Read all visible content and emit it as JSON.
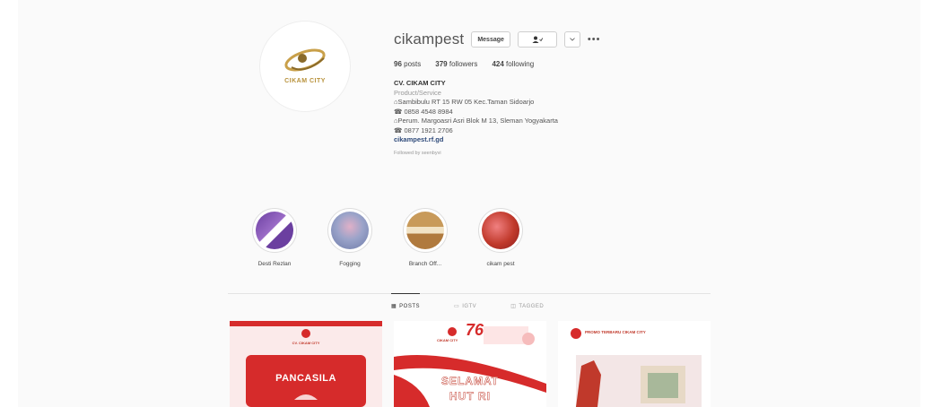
{
  "profile": {
    "username": "cikampest",
    "message_btn": "Message",
    "follow_icon": "person-check-icon",
    "more_icon": "more-icon",
    "avatar_brand": "CIKAM CITY",
    "stats": {
      "posts": "96",
      "posts_label": "posts",
      "followers": "379",
      "followers_label": "followers",
      "following": "424",
      "following_label": "following"
    },
    "bio": {
      "name": "CV. CIKAM CITY",
      "category": "Product/Service",
      "line1": "Sambibulu RT 15 RW 05 Kec.Taman Sidoarjo",
      "line2": "0858 4548 8984",
      "line3": "Perum. Margoasri Asri Blok M 13, Sleman Yogyakarta",
      "line4": "0877 1921 2706",
      "link": "cikampest.rf.gd",
      "followed_by": "Followed by seenbyvi"
    }
  },
  "highlights": [
    {
      "label": "Desti Rezlan"
    },
    {
      "label": "Fogging"
    },
    {
      "label": "Branch Off..."
    },
    {
      "label": "cikam pest"
    }
  ],
  "tabs": [
    {
      "label": "POSTS",
      "icon": "grid-icon"
    },
    {
      "label": "IGTV",
      "icon": "tv-icon"
    },
    {
      "label": "TAGGED",
      "icon": "tag-icon"
    }
  ],
  "posts": [
    {
      "text1": "CV. CIKAM CITY",
      "text2": "PANCASILA"
    },
    {
      "text1": "CIKAM CITY",
      "text2": "76",
      "text3": "SELAMAT",
      "text4": "HUT RI"
    },
    {
      "text1": "PROMO TERBARU CIKAM CITY"
    }
  ],
  "colors": {
    "brand_gold": "#b8923c",
    "accent_red": "#d62b2b",
    "link_blue": "#2e4a7a"
  }
}
